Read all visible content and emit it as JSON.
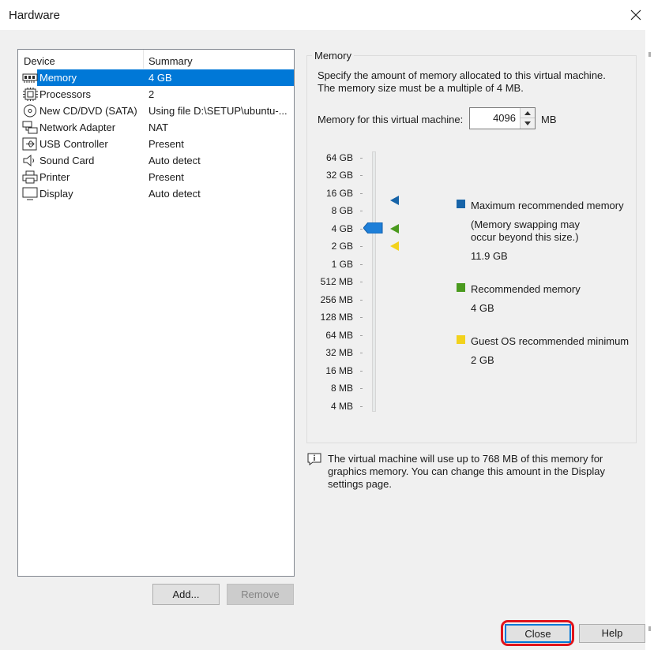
{
  "window": {
    "title": "Hardware"
  },
  "device_list": {
    "header": {
      "device": "Device",
      "summary": "Summary"
    },
    "rows": [
      {
        "name": "Memory",
        "summary": "4 GB",
        "icon": "memory-icon",
        "selected": true
      },
      {
        "name": "Processors",
        "summary": "2",
        "icon": "processor-icon"
      },
      {
        "name": "New CD/DVD (SATA)",
        "summary": "Using file D:\\SETUP\\ubuntu-...",
        "icon": "cd-dvd-icon"
      },
      {
        "name": "Network Adapter",
        "summary": "NAT",
        "icon": "network-adapter-icon"
      },
      {
        "name": "USB Controller",
        "summary": "Present",
        "icon": "usb-icon"
      },
      {
        "name": "Sound Card",
        "summary": "Auto detect",
        "icon": "speaker-icon"
      },
      {
        "name": "Printer",
        "summary": "Present",
        "icon": "printer-icon"
      },
      {
        "name": "Display",
        "summary": "Auto detect",
        "icon": "display-icon"
      }
    ]
  },
  "buttons": {
    "add": "Add...",
    "remove": "Remove",
    "close": "Close",
    "help": "Help"
  },
  "memory": {
    "group_label": "Memory",
    "description_line1": "Specify the amount of memory allocated to this virtual machine.",
    "description_line2": "The memory size must be a multiple of 4 MB.",
    "field_label": "Memory for this virtual machine:",
    "value": "4096",
    "unit": "MB",
    "scale_labels": [
      "64 GB",
      "32 GB",
      "16 GB",
      "8 GB",
      "4 GB",
      "2 GB",
      "1 GB",
      "512 MB",
      "256 MB",
      "128 MB",
      "64 MB",
      "32 MB",
      "16 MB",
      "8 MB",
      "4 MB"
    ],
    "legend": {
      "max": {
        "label": "Maximum recommended memory",
        "note_line1": "(Memory swapping may",
        "note_line2": "occur beyond this size.)",
        "value": "11.9 GB",
        "color": "#1764a8"
      },
      "recommended": {
        "label": "Recommended memory",
        "value": "4 GB",
        "color": "#4a9a1e"
      },
      "guest_min": {
        "label": "Guest OS recommended minimum",
        "value": "2 GB",
        "color": "#f2d21c"
      }
    },
    "info_line1": "The virtual machine will use up to 768 MB of this memory for",
    "info_line2": "graphics memory. You can change this amount in the Display",
    "info_line3": "settings page."
  },
  "colors": {
    "selection": "#0078d7",
    "highlight_ring": "#e0141c",
    "slider_thumb": "#1e7fd8"
  }
}
